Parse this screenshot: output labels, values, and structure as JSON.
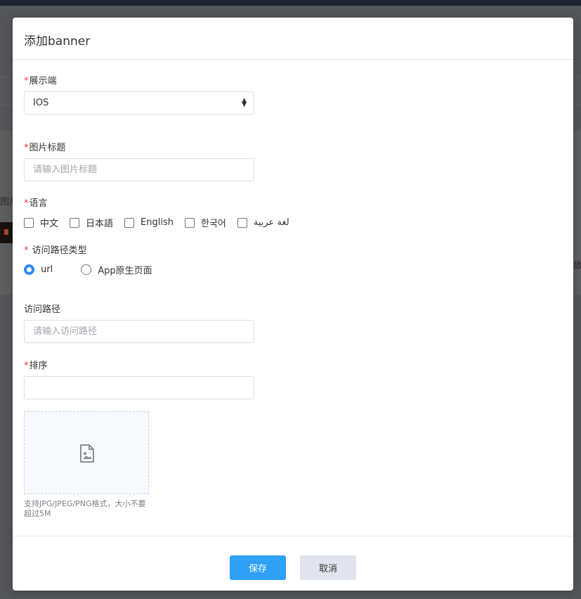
{
  "background": {
    "left_fragment": "图片",
    "right_fragment": "故:"
  },
  "modal": {
    "title": "添加banner",
    "fields": {
      "platform": {
        "label": "展示端",
        "required": true,
        "value": "IOS"
      },
      "image_title": {
        "label": "图片标题",
        "required": true,
        "placeholder": "请输入图片标题",
        "value": ""
      },
      "language": {
        "label": "语言",
        "required": true,
        "options": [
          {
            "label": "中文",
            "checked": false
          },
          {
            "label": "日本語",
            "checked": false
          },
          {
            "label": "English",
            "checked": false
          },
          {
            "label": "한국어",
            "checked": false
          },
          {
            "label": "لغة عربية",
            "checked": false
          }
        ]
      },
      "path_type": {
        "label": "访问路径类型",
        "required": true,
        "options": [
          {
            "label": "url",
            "selected": true
          },
          {
            "label": "App原生页面",
            "selected": false
          }
        ]
      },
      "path": {
        "label": "访问路径",
        "required": false,
        "placeholder": "请输入访问路径",
        "value": ""
      },
      "sort": {
        "label": "排序",
        "required": true,
        "value": ""
      }
    },
    "upload": {
      "icon": "image-placeholder-icon",
      "hint": "支持JPG/JPEG/PNG格式，大小不要超过5M"
    },
    "buttons": {
      "save": "保存",
      "cancel": "取消"
    }
  },
  "colors": {
    "primary": "#2ea0f5",
    "required": "#f04134",
    "cancel_bg": "#e1e3ee"
  }
}
